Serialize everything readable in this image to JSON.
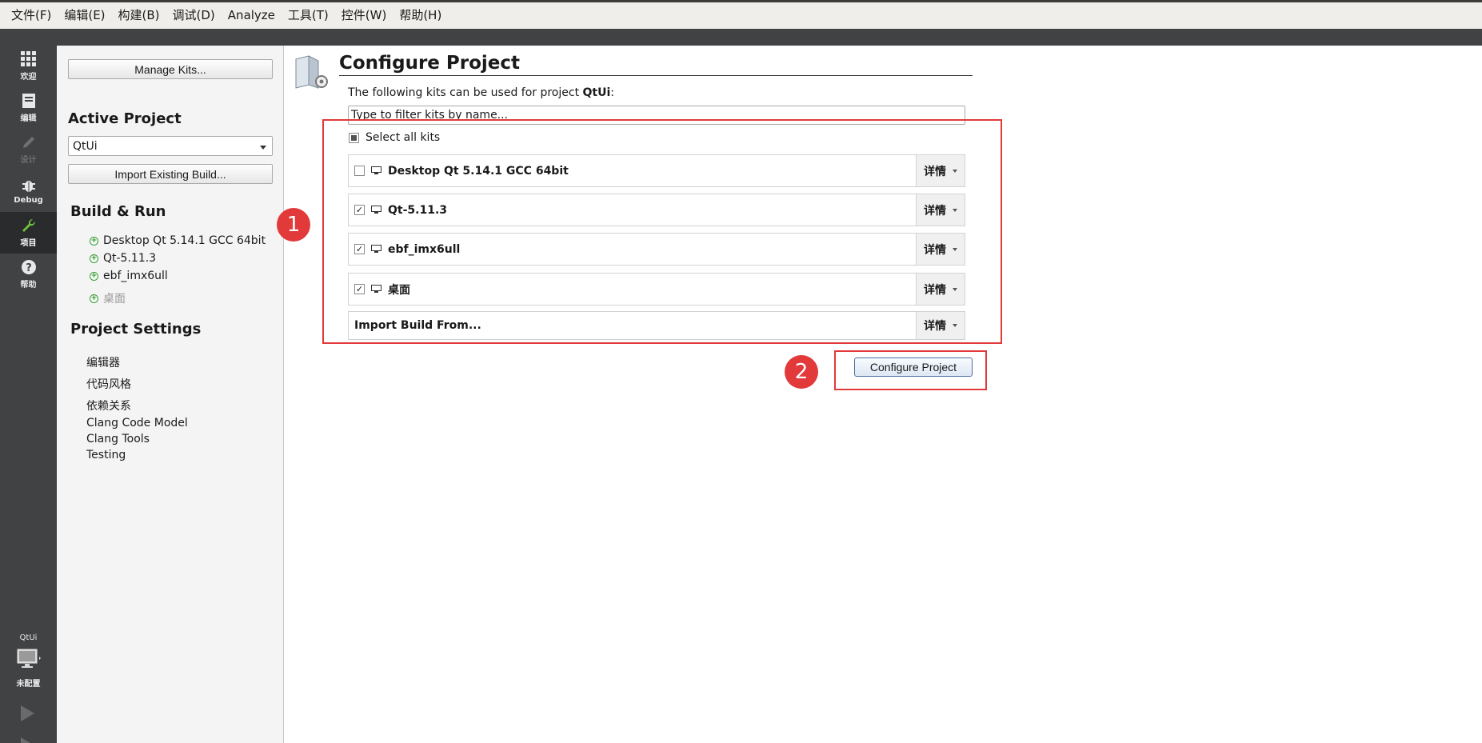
{
  "menu": [
    "文件(F)",
    "编辑(E)",
    "构建(B)",
    "调试(D)",
    "Analyze",
    "工具(T)",
    "控件(W)",
    "帮助(H)"
  ],
  "modes": {
    "welcome": "欢迎",
    "edit": "编辑",
    "design": "设计",
    "debug": "Debug",
    "projects": "项目",
    "help": "帮助"
  },
  "target": {
    "project": "QtUi",
    "status": "未配置"
  },
  "sidebar": {
    "manage_kits": "Manage Kits...",
    "active_project_title": "Active Project",
    "active_project_value": "QtUi",
    "import_existing": "Import Existing Build...",
    "build_run_title": "Build & Run",
    "kits": [
      "Desktop Qt 5.14.1 GCC 64bit",
      "Qt-5.11.3",
      "ebf_imx6ull",
      "桌面"
    ],
    "project_settings_title": "Project Settings",
    "settings": [
      "编辑器",
      "代码风格",
      "依赖关系",
      "Clang Code Model",
      "Clang Tools",
      "Testing"
    ]
  },
  "main": {
    "title": "Configure Project",
    "intro_prefix": "The following kits can be used for project ",
    "intro_project": "QtUi",
    "intro_suffix": ":",
    "filter_placeholder": "Type to filter kits by name...",
    "select_all": "Select all kits",
    "kit_rows": [
      {
        "name": "Desktop Qt 5.14.1 GCC 64bit",
        "checked": false
      },
      {
        "name": "Qt-5.11.3",
        "checked": true
      },
      {
        "name": "ebf_imx6ull",
        "checked": true
      },
      {
        "name": "桌面",
        "checked": true
      }
    ],
    "import_build_from": "Import Build From...",
    "details_label": "详情",
    "configure_button": "Configure Project"
  },
  "annotations": {
    "badge1": "1",
    "badge2": "2",
    "color": "#e23a3a"
  },
  "check_glyph": "✓"
}
